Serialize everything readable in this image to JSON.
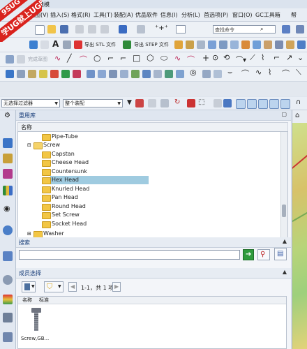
{
  "titlebar": {
    "title": "建模"
  },
  "menubar": {
    "items": [
      "视图(V)",
      "插入(S)",
      "格式(R)",
      "工具(T)",
      "装配(A)",
      "优品软件",
      "信息(I)",
      "分析(L)",
      "首选项(P)",
      "窗口(O)",
      "GC工具箱",
      "帮"
    ]
  },
  "watermark": {
    "line1": "9SUG",
    "line2": "学UG就上UG网"
  },
  "toolbar": {
    "command_search_placeholder": "查找命令",
    "export_stl": "导出 STL 文件",
    "export_step": "导出 STEP 文件",
    "text_label": "A",
    "disabled_label": "完成草图"
  },
  "selection_bar": {
    "filter": "无选择过滤器",
    "scope": "整个装配"
  },
  "reuse_library": {
    "title": "重用库",
    "column_header": "名称",
    "items": [
      {
        "label": "Pipe-Tube",
        "level": 2
      },
      {
        "label": "Screw",
        "level": 1
      },
      {
        "label": "Capstan",
        "level": 2
      },
      {
        "label": "Cheese Head",
        "level": 2
      },
      {
        "label": "Countersunk",
        "level": 2
      },
      {
        "label": "Hex Head",
        "level": 2,
        "selected": true
      },
      {
        "label": "Knurled Head",
        "level": 2
      },
      {
        "label": "Pan Head",
        "level": 2
      },
      {
        "label": "Round Head",
        "level": 2
      },
      {
        "label": "Set Screw",
        "level": 2
      },
      {
        "label": "Socket Head",
        "level": 2
      },
      {
        "label": "Washer",
        "level": 1
      }
    ]
  },
  "search": {
    "title": "搜索",
    "value": ""
  },
  "member_select": {
    "title": "成员选择",
    "pager": "1-1，共 1 项",
    "columns": [
      "名称",
      "标准"
    ],
    "tiles": [
      {
        "label": "Screw,GB..."
      }
    ]
  }
}
